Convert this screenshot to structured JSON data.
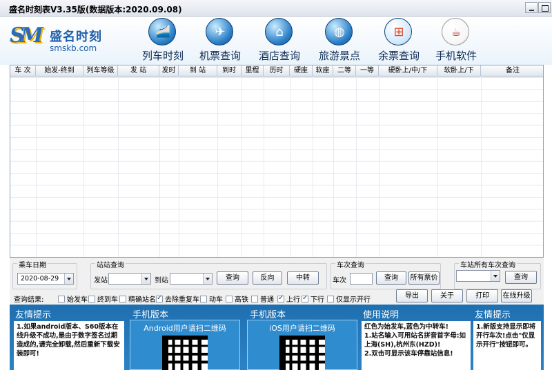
{
  "window": {
    "title": "盛名时刻表V3.35版(数据版本:2020.09.08)"
  },
  "logo": {
    "mark": "SM",
    "name": "盛名时刻",
    "url": "smskb.com"
  },
  "nav": [
    {
      "label": "列车时刻",
      "icon": "train-icon"
    },
    {
      "label": "机票查询",
      "icon": "airplane-icon"
    },
    {
      "label": "酒店查询",
      "icon": "hotel-icon"
    },
    {
      "label": "旅游景点",
      "icon": "globe-icon"
    },
    {
      "label": "余票查询",
      "icon": "windows-icon"
    },
    {
      "label": "手机软件",
      "icon": "java-icon"
    }
  ],
  "columns": [
    "车 次",
    "始发-终到",
    "列车等级",
    "发 站",
    "发时",
    "到 站",
    "到时",
    "里程",
    "历时",
    "硬座",
    "软座",
    "二等",
    "一等",
    "硬卧上/中/下",
    "软卧上/下",
    "备注"
  ],
  "departure_date": {
    "label": "乘车日期",
    "value": "2020-08-29"
  },
  "station_query": {
    "label": "站站查询",
    "from_label": "发站",
    "to_label": "到站",
    "query": "查询",
    "reverse": "反向",
    "transfer": "中转"
  },
  "train_query": {
    "label": "车次查询",
    "field_label": "车次",
    "query": "查询",
    "all_fares": "所有票价"
  },
  "station_trains": {
    "label": "车站所有车次查询",
    "query": "查询"
  },
  "results": {
    "label": "查询结果:",
    "checks": [
      {
        "label": "始发车",
        "checked": false
      },
      {
        "label": "终到车",
        "checked": false
      },
      {
        "label": "精确站名",
        "checked": false
      },
      {
        "label": "去除重复车",
        "checked": true
      },
      {
        "label": "动车",
        "checked": false
      },
      {
        "label": "高铁",
        "checked": false
      },
      {
        "label": "普通",
        "checked": false
      },
      {
        "label": "上行",
        "checked": true
      },
      {
        "label": "下行",
        "checked": true
      },
      {
        "label": "仅显示开行",
        "checked": false
      }
    ]
  },
  "actions": {
    "export": "导出",
    "about": "关于",
    "print": "打印",
    "upgrade": "在线升级"
  },
  "panels": {
    "tip1": {
      "title": "友情提示",
      "text": "1.如果android版本、S60版本在线升级不成功,是由于数字签名过期造成的,请完全卸载,然后重新下载安装即可!"
    },
    "mobile1": {
      "title": "手机版本",
      "card": "Android用户请扫二维码"
    },
    "mobile2": {
      "title": "手机版本",
      "card": "iOS用户请扫二维码"
    },
    "usage": {
      "title": "使用说明",
      "text": "红色为始发车,蓝色为中转车!\n1.站名输入可用站名拼音首字母:如上海(SH),杭州东(HZD)!\n2.双击可显示该车停靠站信息!"
    },
    "tip2": {
      "title": "友情提示",
      "text": "1.新版支持显示即将开行车次!点击\"仅显示开行\"按钮即可。"
    }
  }
}
